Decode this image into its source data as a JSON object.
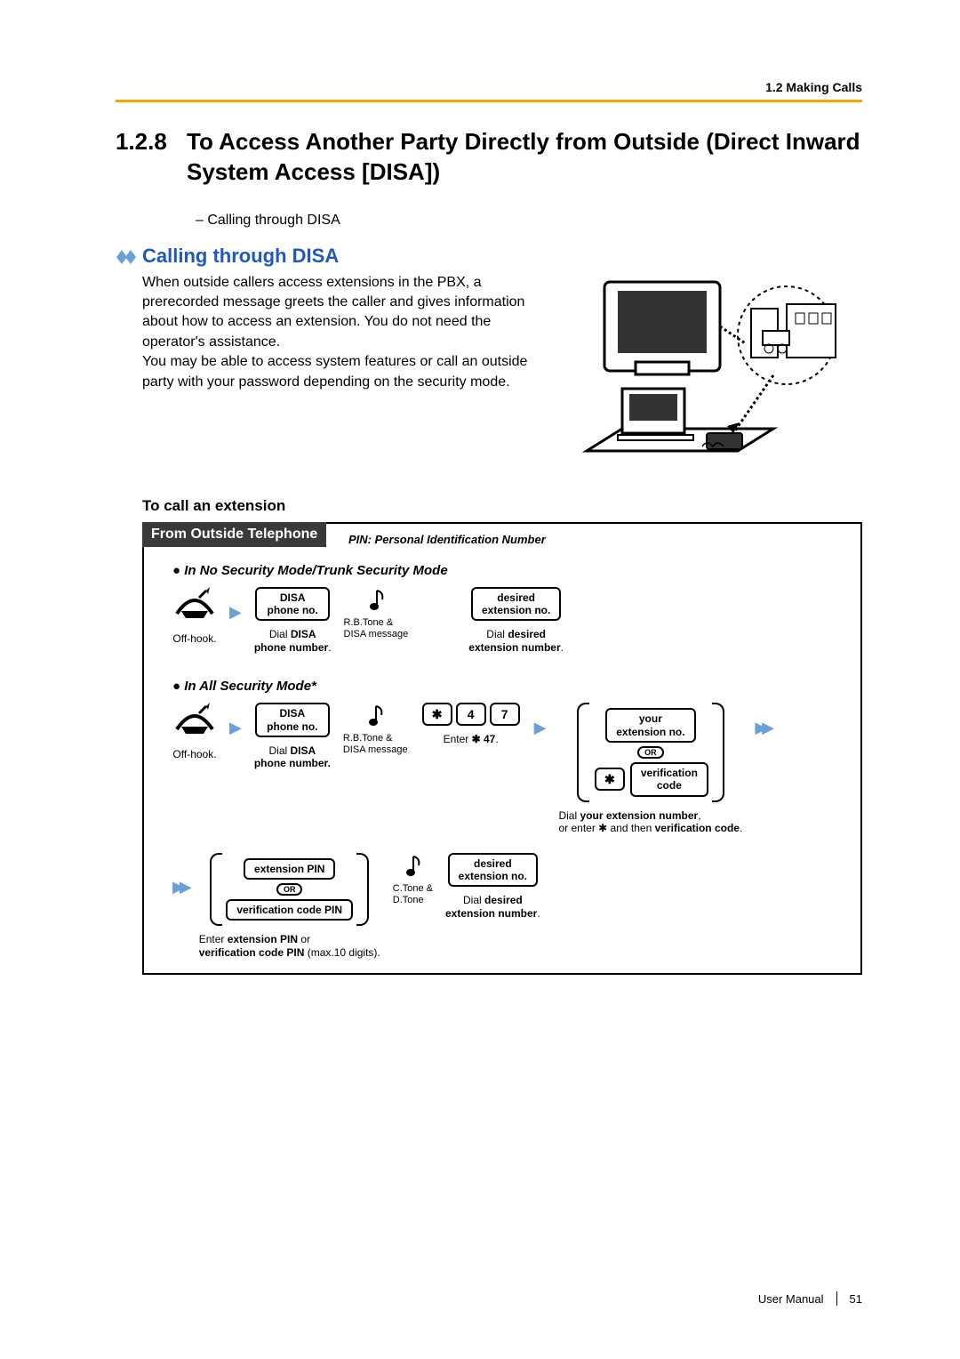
{
  "header": {
    "breadcrumb": "1.2 Making Calls"
  },
  "title": {
    "number": "1.2.8",
    "text": "To Access Another Party Directly from Outside (Direct Inward System Access [DISA])"
  },
  "toc_line": "–    Calling through DISA",
  "subheading": "Calling through DISA",
  "intro": {
    "p1": "When outside callers access extensions in the PBX, a prerecorded message greets the caller and gives information about how to access an extension. You do not need the operator's assistance.",
    "p2": "You may be able to access system features or call an outside party with your password depending on the security mode."
  },
  "procedure": {
    "title": "To call an extension",
    "tab": "From Outside Telephone",
    "note": "PIN: Personal Identification Number",
    "mode1": {
      "label": "In No Security Mode/Trunk Security Mode",
      "offhook": "Off-hook.",
      "disa_box": "DISA\nphone no.",
      "disa_caption": "Dial DISA\nphone number.",
      "rb": "R.B.Tone &\nDISA message",
      "ext_box": "desired\nextension no.",
      "ext_caption": "Dial desired\nextension number."
    },
    "mode2": {
      "label": "In All Security Mode*",
      "offhook": "Off-hook.",
      "disa_box": "DISA\nphone no.",
      "disa_caption": "Dial DISA\nphone number.",
      "rb": "R.B.Tone &\nDISA message",
      "code_star": "✱",
      "code_4": "4",
      "code_7": "7",
      "code_caption": "Enter ✱ 47.",
      "your_ext": "your\nextension no.",
      "or": "OR",
      "verif_box": "verification\ncode",
      "verif_caption": "Dial your extension number,\nor enter ✱ and then verification code.",
      "pin1": "extension PIN",
      "pin2": "verification code PIN",
      "pin_caption": "Enter extension PIN or\nverification code PIN (max.10 digits).",
      "ctone": "C.Tone &\nD.Tone",
      "ext_box": "desired\nextension no.",
      "ext_caption": "Dial desired\nextension number."
    }
  },
  "footer": {
    "label": "User Manual",
    "page": "51"
  }
}
